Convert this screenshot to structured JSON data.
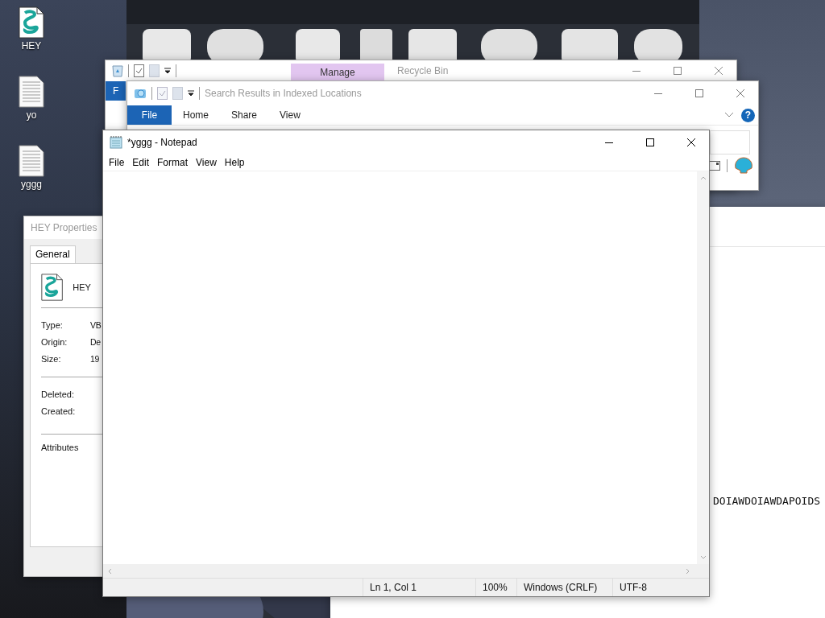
{
  "desktop": {
    "icons": [
      {
        "label": "HEY",
        "kind": "script"
      },
      {
        "label": "yo",
        "kind": "text"
      },
      {
        "label": "yggg",
        "kind": "text"
      }
    ]
  },
  "back_window": {
    "text": "DOIAWDOIAWDAPOIDS"
  },
  "recycle_bin_window": {
    "title": "Recycle Bin",
    "context_tab": "Manage",
    "ribbon_tabs": [
      {
        "label": "F",
        "selected": true
      }
    ]
  },
  "search_window": {
    "title": "Search Results in Indexed Locations",
    "tabs": [
      {
        "label": "File",
        "selected": true
      },
      {
        "label": "Home",
        "selected": false
      },
      {
        "label": "Share",
        "selected": false
      },
      {
        "label": "View",
        "selected": false
      }
    ],
    "help_button": "?"
  },
  "properties_window": {
    "title": "HEY Properties",
    "tabs": [
      {
        "label": "General",
        "selected": true
      }
    ],
    "file_name": "HEY",
    "fields": [
      {
        "label": "Type:",
        "value": "VB"
      },
      {
        "label": "Origin:",
        "value": "De"
      },
      {
        "label": "Size:",
        "value": "19"
      }
    ],
    "dates": [
      {
        "label": "Deleted:"
      },
      {
        "label": "Created:"
      }
    ],
    "attributes_label": "Attributes"
  },
  "notepad": {
    "title": "*yggg - Notepad",
    "menu": [
      "File",
      "Edit",
      "Format",
      "View",
      "Help"
    ],
    "status_bar": [
      "Ln 1, Col 1",
      "100%",
      "Windows (CRLF)",
      "UTF-8"
    ]
  }
}
